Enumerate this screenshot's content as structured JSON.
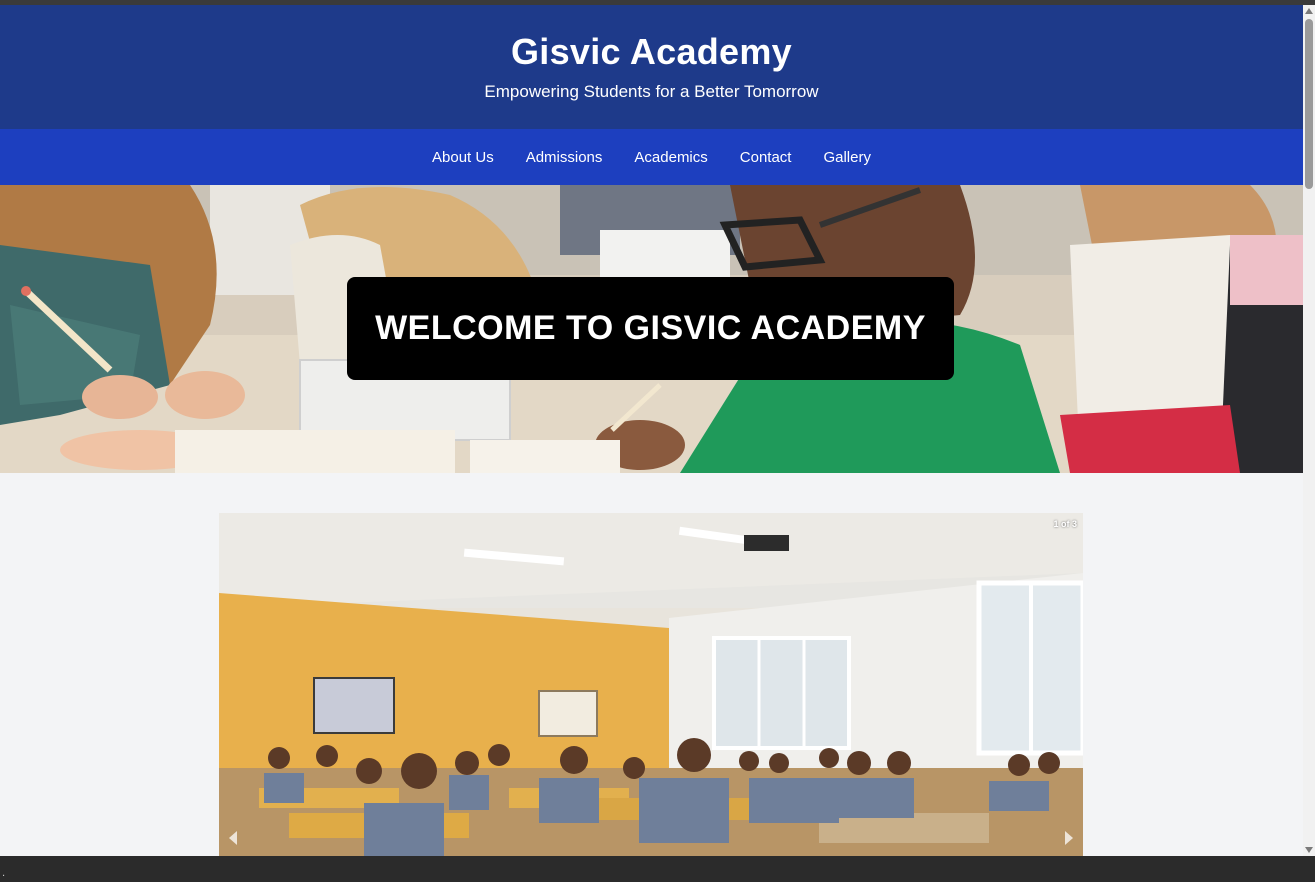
{
  "header": {
    "title": "Gisvic Academy",
    "tagline": "Empowering Students for a Better Tomorrow"
  },
  "nav": {
    "items": [
      {
        "label": "About Us"
      },
      {
        "label": "Admissions"
      },
      {
        "label": "Academics"
      },
      {
        "label": "Contact"
      },
      {
        "label": "Gallery"
      }
    ]
  },
  "hero": {
    "title": "WELCOME TO GISVIC ACADEMY",
    "image": "students-drawing-in-classroom"
  },
  "gallery": {
    "counter": "1 of 3",
    "image": "classroom-of-students-at-desks",
    "prev_icon": "chevron-left-icon",
    "next_icon": "chevron-right-icon"
  },
  "colors": {
    "header_bg": "#1e3a8a",
    "nav_bg": "#1d3fbf",
    "page_bg": "#f3f4f6",
    "banner_bg": "#000000",
    "text_light": "#ffffff"
  }
}
